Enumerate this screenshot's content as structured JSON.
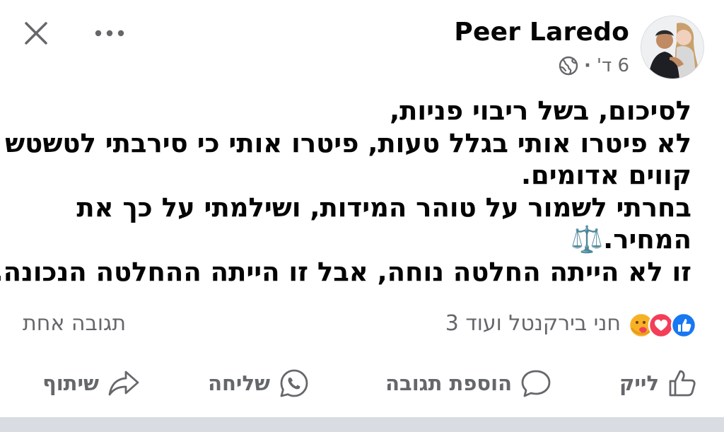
{
  "header": {
    "author": "Peer Laredo",
    "time": "6 ד'",
    "separator": "·",
    "close_icon": "close-icon",
    "more_icon": "more-horizontal-icon",
    "privacy_icon": "globe-icon"
  },
  "post": {
    "lines": [
      "לסיכום, בשל ריבוי פניות,",
      "לא פיטרו אותי בגלל טעות, פיטרו אותי כי סירבתי לטשטש",
      "קווים אדומים.",
      "בחרתי לשמור על טוהר המידות, ושילמתי על כך את",
      "המחיר.⚖️",
      "זו לא הייתה החלטה נוחה, אבל זו הייתה ההחלטה הנכונה."
    ]
  },
  "reactions": {
    "text": "חני בירקנטל ועוד 3",
    "comments": "תגובה אחת",
    "icons": [
      "like-reaction-icon",
      "love-reaction-icon",
      "care-reaction-icon"
    ],
    "colors": {
      "like": "#1877f2",
      "love": "#f33e58",
      "care": "#f7b125"
    }
  },
  "actions": {
    "like": "לייק",
    "comment": "הוספת תגובה",
    "send": "שליחה",
    "share": "שיתוף"
  }
}
